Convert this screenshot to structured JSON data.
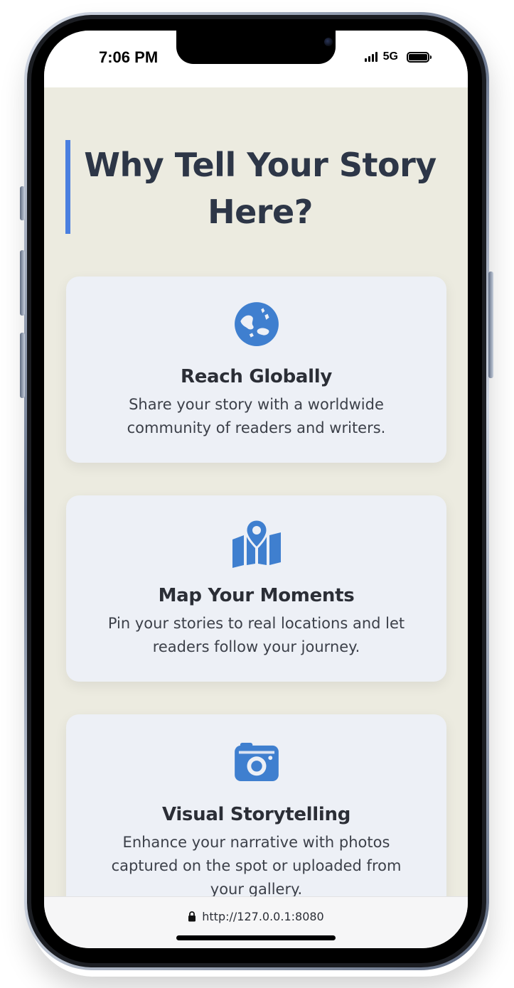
{
  "status_bar": {
    "time": "7:06 PM",
    "network": "5G"
  },
  "section": {
    "title": "Why Tell Your Story Here?",
    "accent_color": "#4a7fe0"
  },
  "features": [
    {
      "icon": "globe-icon",
      "title": "Reach Globally",
      "description": "Share your story with a worldwide community of readers and writers."
    },
    {
      "icon": "map-pin-icon",
      "title": "Map Your Moments",
      "description": "Pin your stories to real locations and let readers follow your journey."
    },
    {
      "icon": "camera-icon",
      "title": "Visual Storytelling",
      "description": "Enhance your narrative with photos captured on the spot or uploaded from your gallery."
    }
  ],
  "icon_color": "#3f7fcf",
  "browser": {
    "url": "http://127.0.0.1:8080"
  }
}
